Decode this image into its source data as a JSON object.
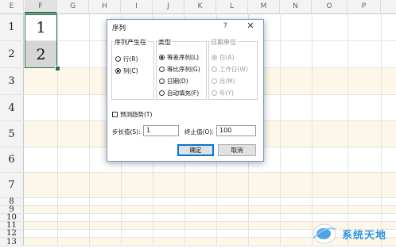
{
  "spreadsheet": {
    "columns": [
      "E",
      "F",
      "G",
      "H",
      "I",
      "J",
      "K",
      "L",
      "M",
      "N",
      "O",
      "P"
    ],
    "active_column": "F",
    "rows": [
      "1",
      "2",
      "3",
      "4",
      "5",
      "6",
      "7",
      "8",
      "9",
      "10",
      "11",
      "12",
      "13"
    ],
    "cells": {
      "F1": "1",
      "F2": "2"
    }
  },
  "dialog": {
    "title": "序列",
    "help_label": "?",
    "close_label": "✕",
    "series_in": {
      "title": "序列产生在",
      "options": [
        {
          "label": "行(R)",
          "checked": false
        },
        {
          "label": "列(C)",
          "checked": true
        }
      ]
    },
    "type": {
      "title": "类型",
      "options": [
        {
          "label": "等差序列(L)",
          "checked": true
        },
        {
          "label": "等比序列(G)",
          "checked": false
        },
        {
          "label": "日期(D)",
          "checked": false
        },
        {
          "label": "自动填充(F)",
          "checked": false
        }
      ]
    },
    "date_unit": {
      "title": "日期单位",
      "disabled": true,
      "options": [
        {
          "label": "日(A)",
          "checked": true
        },
        {
          "label": "工作日(W)",
          "checked": false
        },
        {
          "label": "月(M)",
          "checked": false
        },
        {
          "label": "年(Y)",
          "checked": false
        }
      ]
    },
    "trend": {
      "label": "预测趋势(T)",
      "checked": false
    },
    "step": {
      "label": "步长值(S):",
      "value": "1"
    },
    "stop": {
      "label": "终止值(O):",
      "value": "100"
    },
    "ok_label": "确定",
    "cancel_label": "取消"
  },
  "watermark": {
    "text": "系统天地"
  }
}
